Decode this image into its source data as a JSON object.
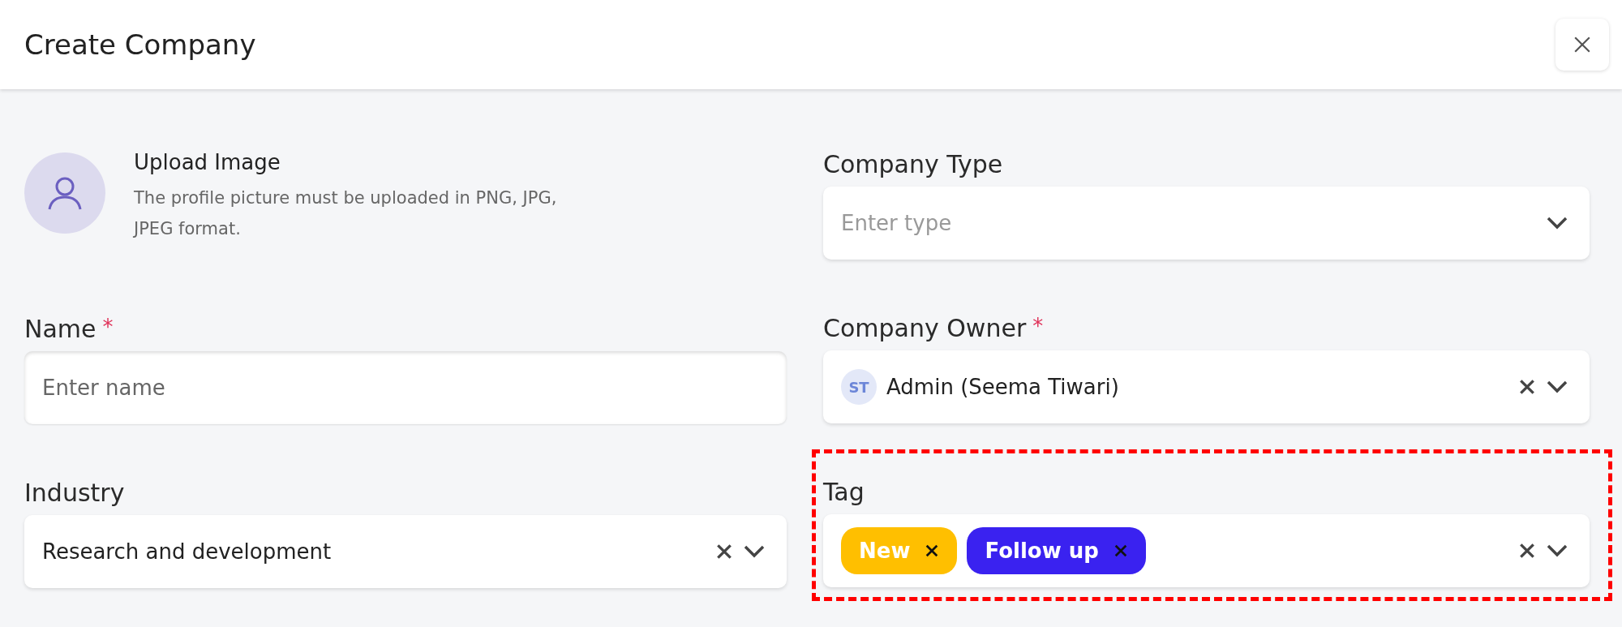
{
  "dialog": {
    "title": "Create Company"
  },
  "upload": {
    "title": "Upload Image",
    "description": "The profile picture must be uploaded in PNG, JPG, JPEG format."
  },
  "fields": [
    {
      "kind": "select",
      "label": "Company Type",
      "placeholder": "Enter type",
      "clearable": false
    },
    {
      "kind": "input",
      "label": "Name",
      "required_mark": "*",
      "placeholder": "Enter name"
    },
    {
      "kind": "user",
      "label": "Company Owner",
      "required_mark": "*",
      "initials": "ST",
      "value": "Admin (Seema Tiwari)",
      "clearable": true
    },
    {
      "kind": "select",
      "label": "Industry",
      "value": "Research and development",
      "clearable": true
    },
    {
      "kind": "tags",
      "label": "Tag",
      "highlighted": true,
      "clearable": true,
      "tags": [
        {
          "label": "New",
          "color": "#ffbf00"
        },
        {
          "label": "Follow up",
          "color": "#3a22f0"
        }
      ]
    }
  ]
}
